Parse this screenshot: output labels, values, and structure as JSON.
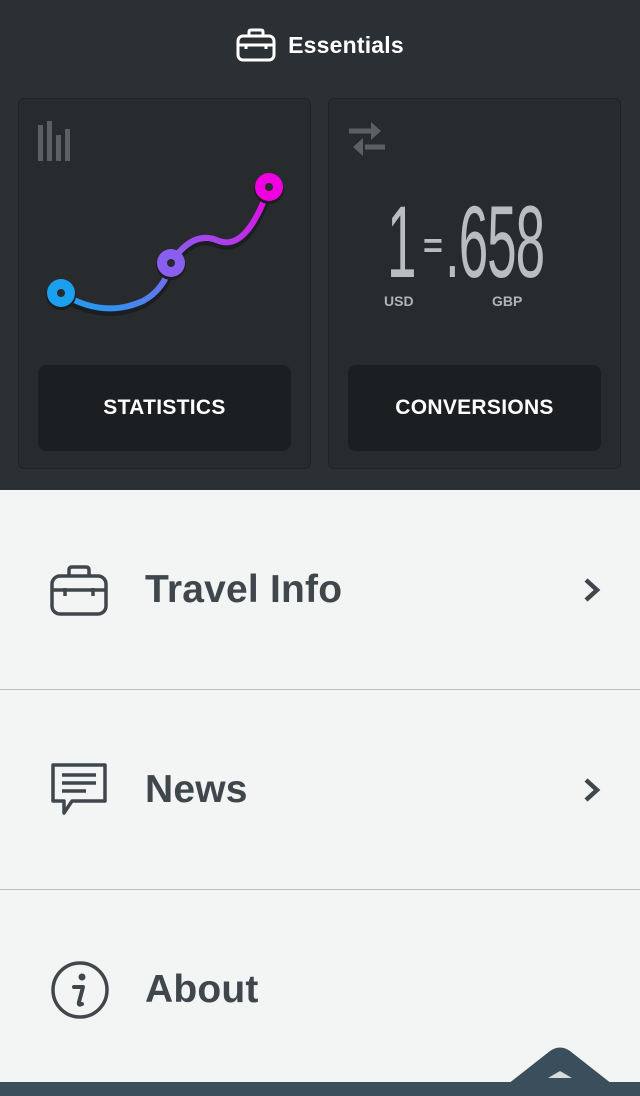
{
  "header": {
    "title": "Essentials",
    "icon": "briefcase-icon"
  },
  "cards": {
    "statistics": {
      "label": "STATISTICS",
      "icon": "bar-chart-icon"
    },
    "conversions": {
      "label": "CONVERSIONS",
      "icon": "swap-arrows-icon",
      "rate": {
        "from_value": "1",
        "equals": "=",
        "to_value": ".658",
        "from_currency": "USD",
        "to_currency": "GBP"
      }
    }
  },
  "menu": {
    "items": [
      {
        "label": "Travel Info",
        "icon": "briefcase-icon"
      },
      {
        "label": "News",
        "icon": "speech-bubble-icon"
      },
      {
        "label": "About",
        "icon": "info-icon"
      }
    ]
  },
  "colors": {
    "top_bg": "#2b3034",
    "menu_bg": "#f3f5f4",
    "menu_text": "#3f474c",
    "chart_blue": "#1aa0ee",
    "chart_purple": "#8a5ef0",
    "chart_magenta": "#f000e0",
    "bottom_bar": "#3a4f5b"
  }
}
